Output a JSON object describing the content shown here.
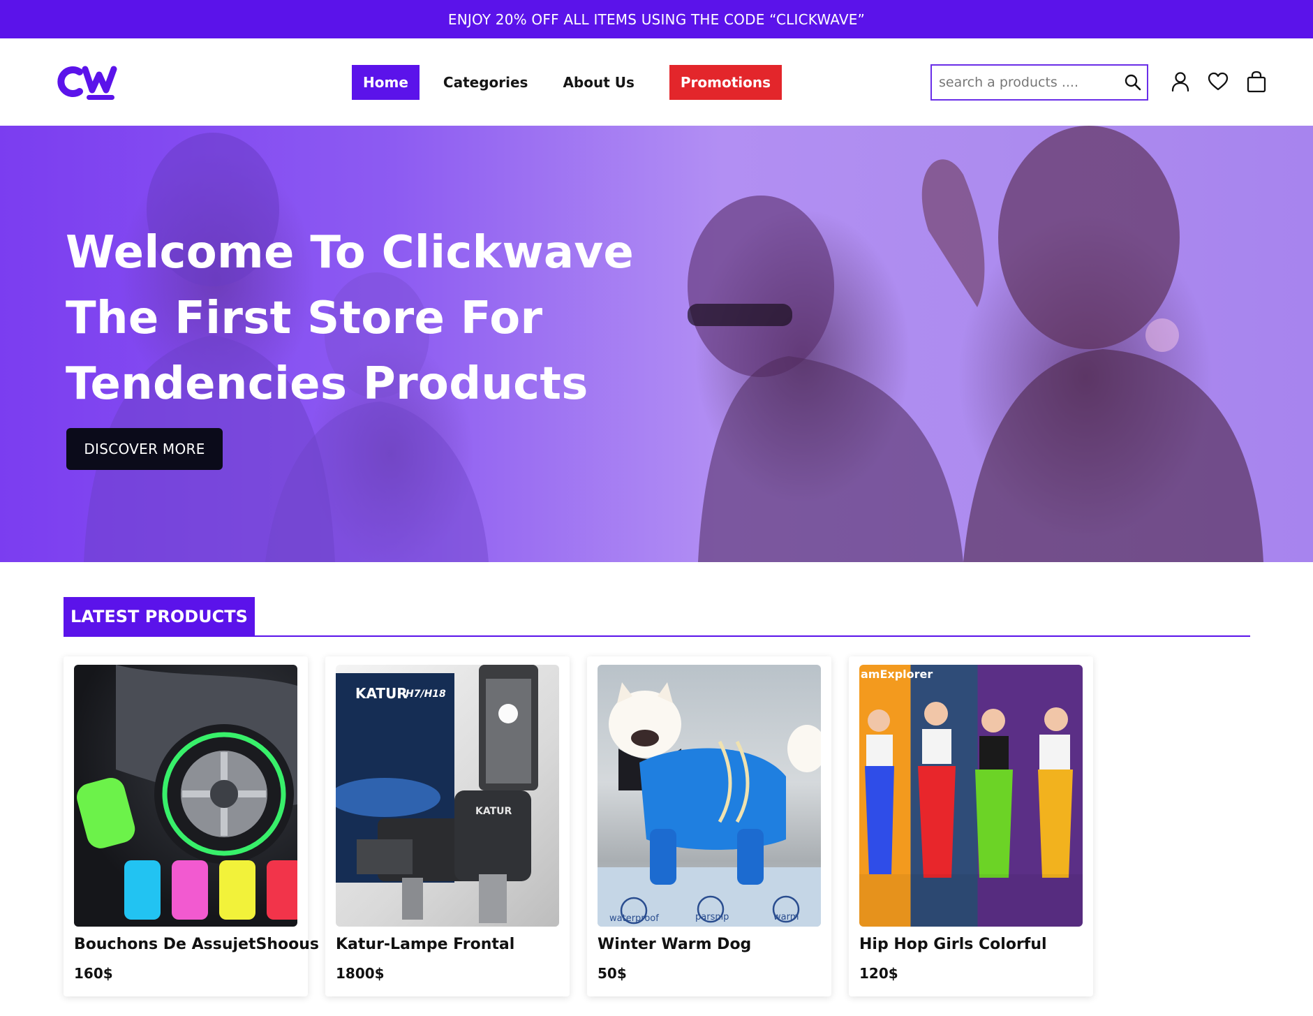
{
  "promo_bar": {
    "text": "ENJOY 20% OFF ALL ITEMS USING THE CODE “CLICKWAVE”"
  },
  "header": {
    "logo_text": "CW",
    "nav": [
      {
        "label": "Home",
        "active": true
      },
      {
        "label": "Categories"
      },
      {
        "label": "About Us"
      },
      {
        "label": "Promotions"
      }
    ],
    "search": {
      "placeholder": "search a products ....",
      "value": ""
    },
    "icons": [
      "search-icon",
      "user-icon",
      "heart-icon",
      "bag-icon"
    ]
  },
  "hero": {
    "title_lines": [
      "Welcome To Clickwave",
      "The First Store For",
      "Tendencies Products"
    ],
    "button_label": "DISCOVER MORE"
  },
  "latest": {
    "title": "LATEST PRODUCTS",
    "products": [
      {
        "name": "Bouchons De AssujetShoous",
        "price": "160$"
      },
      {
        "name": "Katur-Lampe Frontal",
        "price": "1800$",
        "image_text": [
          "KATUR",
          "H7/H18",
          "KATUR"
        ]
      },
      {
        "name": "Winter Warm Dog",
        "price": "50$",
        "image_text": [
          "waterproof",
          "parsnip",
          "warm"
        ]
      },
      {
        "name": "Hip Hop Girls Colorful",
        "price": "120$",
        "image_text": [
          "amExplorer"
        ]
      }
    ]
  },
  "colors": {
    "brand": "#5b13ea",
    "promo_red": "#e3262b",
    "dark_button": "#0b0b1a"
  }
}
